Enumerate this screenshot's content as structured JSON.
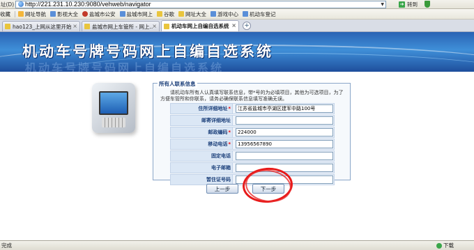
{
  "browser": {
    "address_label": "址(D)",
    "url": "http://221.231.10.230:9080/vehweb/navigator",
    "go_label": "转到",
    "favorites_label": "收藏",
    "favorites": [
      "网址导航",
      "影视大全",
      "盐城市公安",
      "盐城市网上",
      "谷歌",
      "网址大全",
      "游戏中心",
      "机动车登记"
    ],
    "tabs": [
      "hao123_上网从这里开始",
      "盐城市网上车管所 - 网上...",
      "机动车网上自编自选系统"
    ],
    "active_tab": 2,
    "status_text": "完成",
    "download_label": "下载"
  },
  "banner": {
    "title": "机动车号牌号码网上自编自选系统",
    "ghost_text": "机动车号牌号码网上自编自选系统"
  },
  "panel": {
    "legend": "所有人联系信息",
    "notice": "请机动车所有人认真填写联系信息，带*号的为必填项目，其他为可选项目，为了方便车管所和你联系，请务必确保联系信息填写准确无误。",
    "fields": [
      {
        "label": "住所详细地址",
        "required": true,
        "value": "江苏省盐城市亭湖区建军中路100号"
      },
      {
        "label": "邮寄详细地址",
        "required": false,
        "value": ""
      },
      {
        "label": "邮政编码",
        "required": true,
        "value": "224000"
      },
      {
        "label": "移动电话",
        "required": true,
        "value": "13956567890"
      },
      {
        "label": "固定电话",
        "required": false,
        "value": ""
      },
      {
        "label": "电子邮箱",
        "required": false,
        "value": ""
      },
      {
        "label": "暂住证号码",
        "required": false,
        "value": ""
      }
    ],
    "required_mark": "*"
  },
  "buttons": {
    "prev": "上一步",
    "next": "下一步"
  },
  "colors": {
    "banner_blue": "#2a63b4",
    "label_bg": "#dbe7f5",
    "required_red": "#ee0000",
    "annotation_red": "#e81a1a"
  }
}
